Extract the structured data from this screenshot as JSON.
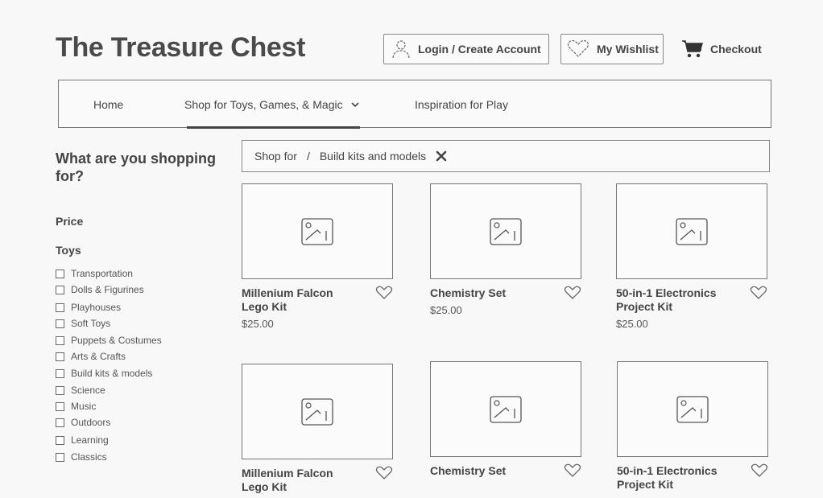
{
  "header": {
    "title": "The Treasure Chest",
    "login_label": "Login / Create Account",
    "wishlist_label": "My Wishlist",
    "checkout_label": "Checkout"
  },
  "nav": {
    "items": [
      "Home",
      "Shop for Toys, Games, & Magic",
      "Inspiration for Play"
    ]
  },
  "sidebar": {
    "heading": "What are you shopping for?",
    "price_label": "Price",
    "toys_label": "Toys",
    "toys": [
      "Transportation",
      "Dolls & Figurines",
      "Playhouses",
      "Soft Toys",
      "Puppets & Costumes",
      "Arts & Crafts",
      "Build kits & models",
      "Science",
      "Music",
      "Outdoors",
      "Learning",
      "Classics"
    ]
  },
  "breadcrumb": {
    "root": "Shop for",
    "separator": "/",
    "current": "Build kits and models"
  },
  "products": [
    {
      "name": "Millenium Falcon Lego Kit",
      "price": "$25.00"
    },
    {
      "name": "Chemistry Set",
      "price": "$25.00"
    },
    {
      "name": "50-in-1 Electronics Project Kit",
      "price": "$25.00"
    },
    {
      "name": "Millenium Falcon Lego Kit",
      "price": ""
    },
    {
      "name": "Chemistry Set",
      "price": ""
    },
    {
      "name": "50-in-1 Electronics Project Kit",
      "price": ""
    }
  ],
  "icons": {
    "login": "user-icon",
    "wishlist": "heart-icon",
    "checkout": "cart-icon",
    "dropdown": "chevron-down-icon",
    "clear": "close-icon",
    "image_placeholder": "image-placeholder-icon"
  }
}
